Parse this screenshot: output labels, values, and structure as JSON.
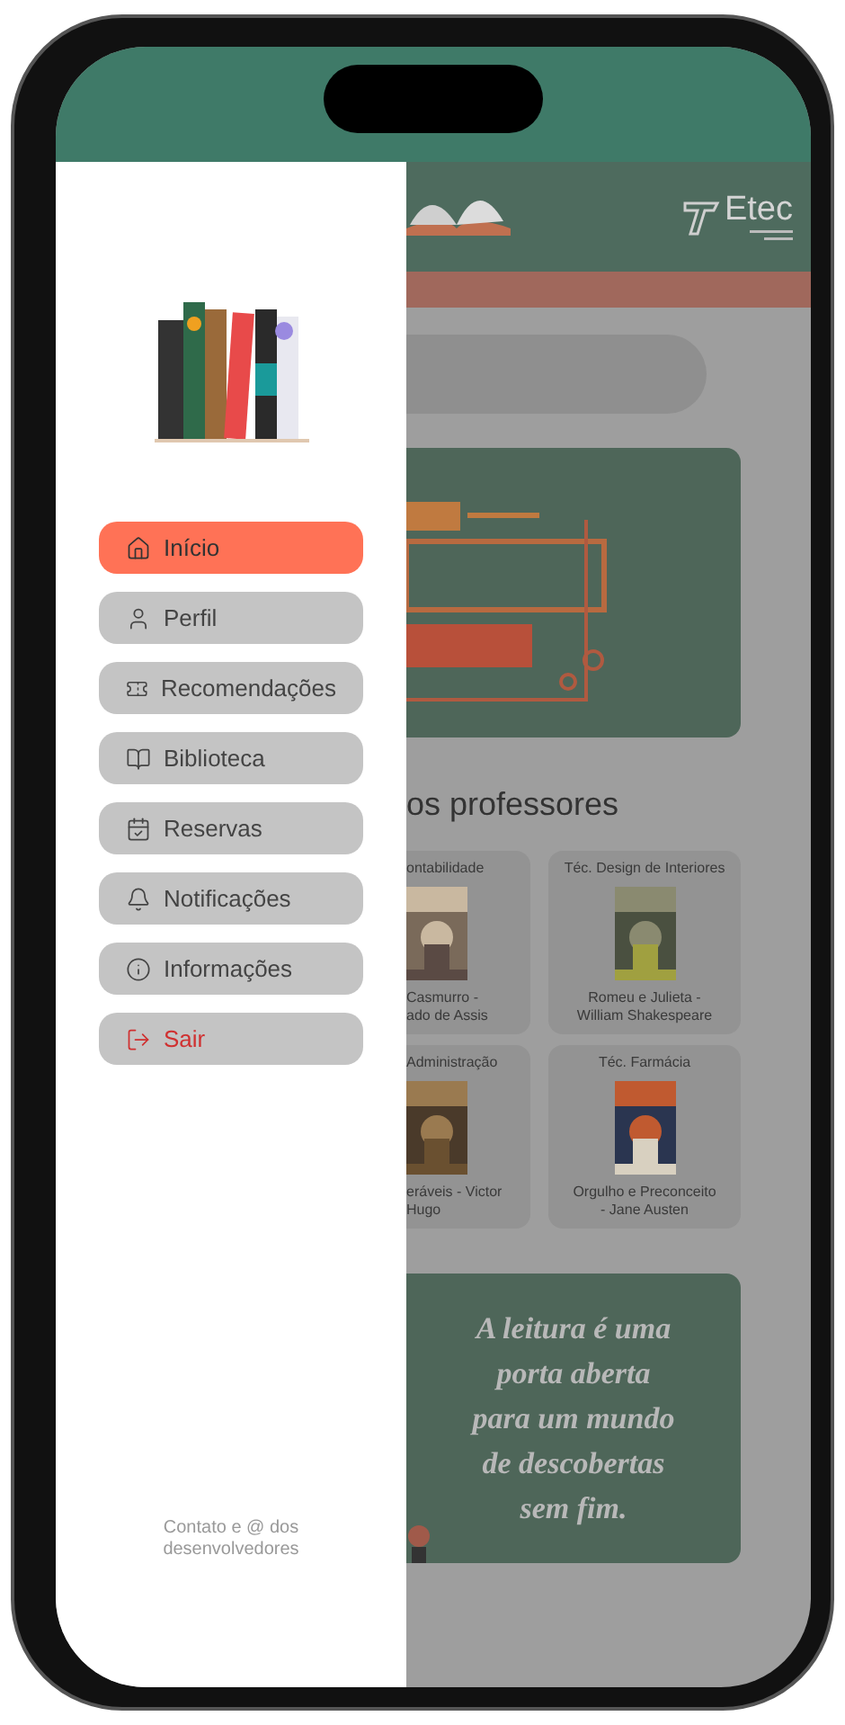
{
  "drawer": {
    "menu": [
      {
        "label": "Início",
        "kind": "home",
        "selected": true
      },
      {
        "label": "Perfil",
        "kind": "profile",
        "selected": false
      },
      {
        "label": "Recomendações",
        "kind": "recommendations",
        "selected": false
      },
      {
        "label": "Biblioteca",
        "kind": "library",
        "selected": false
      },
      {
        "label": "Reservas",
        "kind": "reservations",
        "selected": false
      },
      {
        "label": "Notificações",
        "kind": "notifications",
        "selected": false
      },
      {
        "label": "Informações",
        "kind": "info",
        "selected": false
      },
      {
        "label": "Sair",
        "kind": "logout",
        "selected": false
      }
    ],
    "footer": "Contato e @ dos desenvolvedores"
  },
  "page": {
    "header": {
      "logo_text": "Etec"
    },
    "section_title": "os professores",
    "cards": [
      {
        "course": "ontabilidade",
        "title_lines": [
          "Casmurro -",
          "ado de Assis"
        ],
        "cut": true
      },
      {
        "course": "Téc. Design de Interiores",
        "title_lines": [
          "Romeu e Julieta -",
          "William Shakespeare"
        ],
        "cut": false
      },
      {
        "course": "Administração",
        "title_lines": [
          "eráveis - Victor",
          "Hugo"
        ],
        "cut": true
      },
      {
        "course": "Téc. Farmácia",
        "title_lines": [
          "Orgulho e Preconceito",
          "- Jane Austen"
        ],
        "cut": false
      }
    ],
    "quote_lines": [
      "A leitura é uma",
      "porta aberta",
      "para um mundo",
      "de descobertas",
      "sem fim."
    ]
  }
}
